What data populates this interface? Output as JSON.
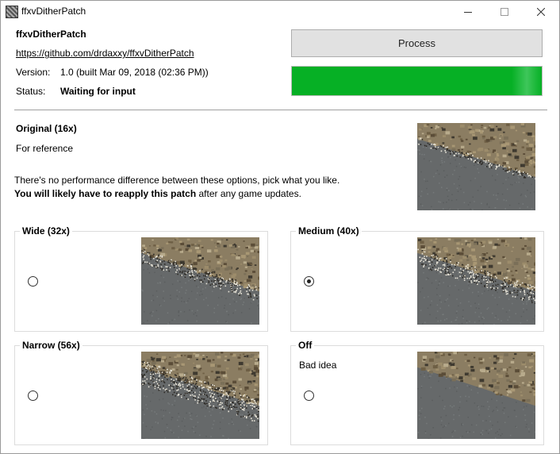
{
  "window": {
    "title": "ffxvDitherPatch",
    "controls": {
      "minimize": "minimize-icon",
      "maximize": "maximize-icon",
      "close": "close-icon"
    }
  },
  "header": {
    "app_name": "ffxvDitherPatch",
    "url": "https://github.com/drdaxxy/ffxvDitherPatch",
    "version_label": "Version:",
    "version_value": "1.0 (built Mar 09, 2018 (02:36 PM))",
    "status_label": "Status:",
    "status_value": "Waiting for input"
  },
  "process_button": {
    "label": "Process"
  },
  "progress": {
    "fraction": 1.0,
    "color": "#06b025"
  },
  "original": {
    "title": "Original (16x)",
    "subtitle": "For reference",
    "note_line1": "There's no performance difference between these options, pick what you like.",
    "note_line2_bold": "You will likely have to reapply this patch",
    "note_line2_rest": " after any game updates."
  },
  "options": [
    {
      "label": "Wide (32x)",
      "description": "",
      "selected": false
    },
    {
      "label": "Medium (40x)",
      "description": "",
      "selected": true
    },
    {
      "label": "Narrow (56x)",
      "description": "",
      "selected": false
    },
    {
      "label": "Off",
      "description": "Bad idea",
      "selected": false
    }
  ]
}
